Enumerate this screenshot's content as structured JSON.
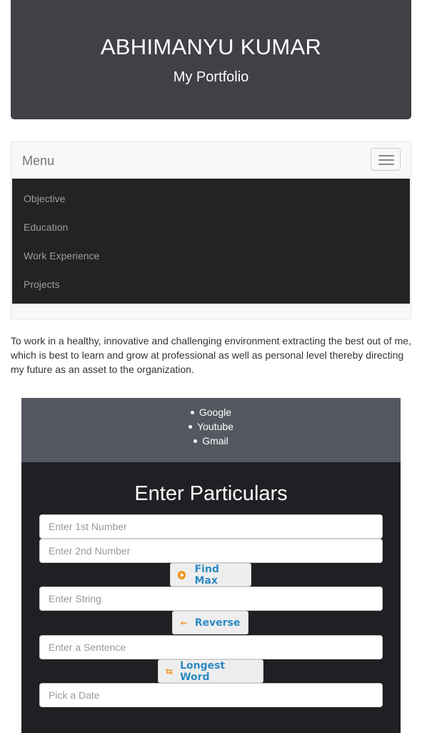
{
  "header": {
    "title": "ABHIMANYU KUMAR",
    "subtitle": "My Portfolio"
  },
  "navbar": {
    "brand": "Menu",
    "items": [
      "Objective",
      "Education",
      "Work Experience",
      "Projects"
    ]
  },
  "objective": {
    "text": "To work in a healthy, innovative and challenging environment extracting the best out of me, which is best to learn and grow at professional as well as personal level thereby directing my future as an asset to the organization."
  },
  "links": [
    "Google",
    "Youtube",
    "Gmail"
  ],
  "form": {
    "title": "Enter Particulars",
    "first_number_placeholder": "Enter 1st Number",
    "second_number_placeholder": "Enter 2nd Number",
    "find_max_label": "Find Max",
    "string_placeholder": "Enter String",
    "reverse_label": "Reverse",
    "sentence_placeholder": "Enter a Sentence",
    "longest_word_label": "Longest Word",
    "date_placeholder": "Pick a Date"
  },
  "icons": {
    "find_max": "play-circle-icon",
    "reverse": "arrow-left-icon",
    "longest_word": "swap-arrows-icon",
    "menu": "hamburger-icon"
  },
  "colors": {
    "header_bg": "#3f4146",
    "menu_bg": "#232323",
    "links_bg": "#555860",
    "form_bg": "#1f2023",
    "button_text": "#2c8ac4",
    "button_icon": "#f0961d"
  }
}
